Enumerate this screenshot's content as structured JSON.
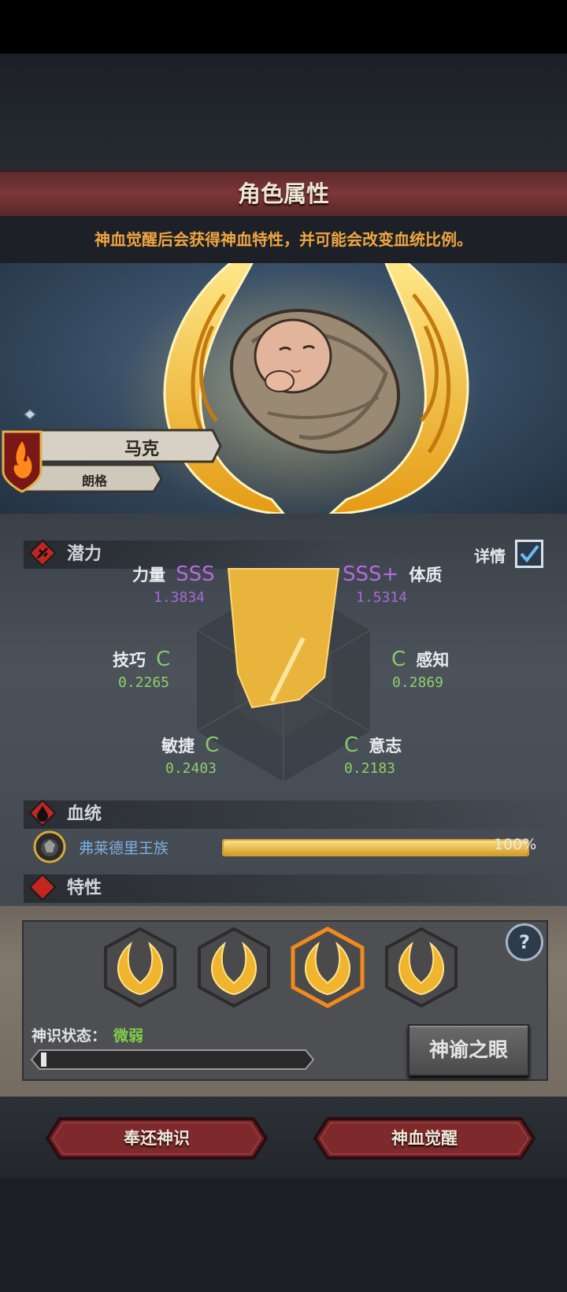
{
  "header": {
    "title": "角色属性",
    "hint": "神血觉醒后会获得神血特性，并可能会改变血统比例。"
  },
  "character": {
    "first_name": "马克",
    "last_name": "朗格"
  },
  "potential": {
    "section_label": "潜力",
    "details_label": "详情",
    "details_checked": true,
    "stats": [
      {
        "name": "力量",
        "grade": "SSS",
        "value": "1.3834",
        "tier": "purple"
      },
      {
        "name": "体质",
        "grade": "SSS+",
        "value": "1.5314",
        "tier": "purple"
      },
      {
        "name": "技巧",
        "grade": "C",
        "value": "0.2265",
        "tier": "green"
      },
      {
        "name": "感知",
        "grade": "C",
        "value": "0.2869",
        "tier": "green"
      },
      {
        "name": "敏捷",
        "grade": "C",
        "value": "0.2403",
        "tier": "green"
      },
      {
        "name": "意志",
        "grade": "C",
        "value": "0.2183",
        "tier": "green"
      }
    ]
  },
  "bloodline": {
    "section_label": "血统",
    "entries": [
      {
        "name": "弗莱德里王族",
        "percent_text": "100%",
        "fraction": 1.0
      }
    ]
  },
  "trait_section_partial": "特性",
  "divine": {
    "status_label": "神识状态：",
    "status_value": "微弱",
    "progress_fraction": 0.02,
    "slots": [
      {
        "selected": false
      },
      {
        "selected": false
      },
      {
        "selected": true
      },
      {
        "selected": false
      }
    ],
    "help_glyph": "?",
    "oracle_button": "神谕之眼"
  },
  "actions": {
    "return_label": "奉还神识",
    "awaken_label": "神血觉醒"
  },
  "colors": {
    "purple": "#b46ae0",
    "green": "#89c86a",
    "gold": "#e8b43c",
    "orange_hint": "#f0a640"
  }
}
